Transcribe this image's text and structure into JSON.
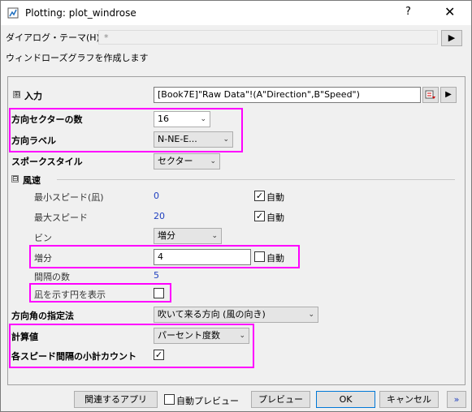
{
  "window": {
    "title": "Plotting: plot_windrose",
    "help": "?",
    "close": "✕"
  },
  "theme": {
    "label": "ダイアログ・テーマ(H)",
    "value": "*",
    "arrow": "▶"
  },
  "description": "ウィンドローズグラフを作成します",
  "form": {
    "input": {
      "expander": "⊞",
      "label": "入力",
      "value": "[Book7E]\"Raw Data\"!(A\"Direction\",B\"Speed\")"
    },
    "sectors": {
      "label": "方向セクターの数",
      "value": "16"
    },
    "direction_label": {
      "label": "方向ラベル",
      "value": "N-NE-E..."
    },
    "stack_style": {
      "label": "スポークスタイル",
      "value": "セクター"
    },
    "wind_speed": {
      "expander": "⊟",
      "label": "風速",
      "min": {
        "label": "最小スピード(凪)",
        "value": "0",
        "auto_label": "自動",
        "auto_checked": true
      },
      "max": {
        "label": "最大スピード",
        "value": "20",
        "auto_label": "自動",
        "auto_checked": true
      },
      "bin": {
        "label": "ビン",
        "value": "増分"
      },
      "increment": {
        "label": "増分",
        "value": "4",
        "auto_label": "自動",
        "auto_checked": false
      },
      "interval_count": {
        "label": "間隔の数",
        "value": "5"
      },
      "calm_circle": {
        "label": "凪を示す円を表示",
        "checked": false
      }
    },
    "angle_spec": {
      "label": "方向角の指定法",
      "value": "吹いて来る方向 (風の向き)"
    },
    "calc_value": {
      "label": "計算値",
      "value": "パーセント度数"
    },
    "subtotal": {
      "label": "各スピード間隔の小計カウント",
      "checked": true
    }
  },
  "footer": {
    "related_apps": "関連するアプリ",
    "auto_preview": "自動プレビュー",
    "preview": "プレビュー",
    "ok": "OK",
    "cancel": "キャンセル",
    "more": "»"
  },
  "check_mark": "✓",
  "combo_arrow": "⌄",
  "colors": {
    "highlight": "#ff00ff",
    "value_blue": "#1f3fbf"
  }
}
